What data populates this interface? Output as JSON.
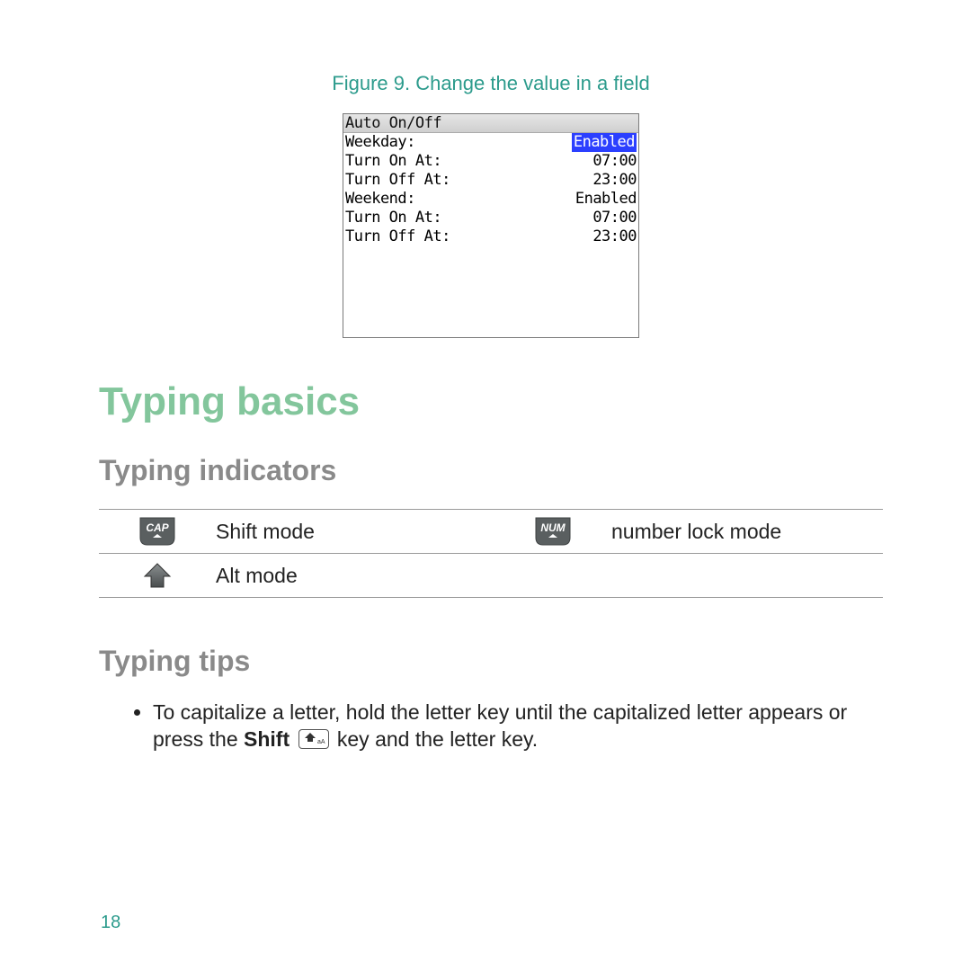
{
  "figure": {
    "caption": "Figure 9. Change the value in a field"
  },
  "device": {
    "title": "Auto On/Off",
    "rows": [
      {
        "label": "Weekday:",
        "value": "Enabled",
        "highlight": true
      },
      {
        "label": "Turn On At:",
        "value": "07:00"
      },
      {
        "label": "Turn Off At:",
        "value": "23:00"
      },
      {
        "label": "Weekend:",
        "value": "Enabled"
      },
      {
        "label": "Turn On At:",
        "value": "07:00"
      },
      {
        "label": "Turn Off At:",
        "value": "23:00"
      }
    ]
  },
  "headings": {
    "h1": "Typing basics",
    "h2a": "Typing indicators",
    "h2b": "Typing tips"
  },
  "indicators": {
    "r1c1_label": "Shift mode",
    "r1c2_label": "number lock mode",
    "r2c1_label": "Alt mode"
  },
  "tips": {
    "item1_a": "To capitalize a letter, hold the letter key until the capitalized letter appears or press the ",
    "item1_bold": "Shift",
    "item1_b": " key and the letter key."
  },
  "page_number": "18",
  "icon_text": {
    "cap": "CAP",
    "num": "NUM"
  }
}
